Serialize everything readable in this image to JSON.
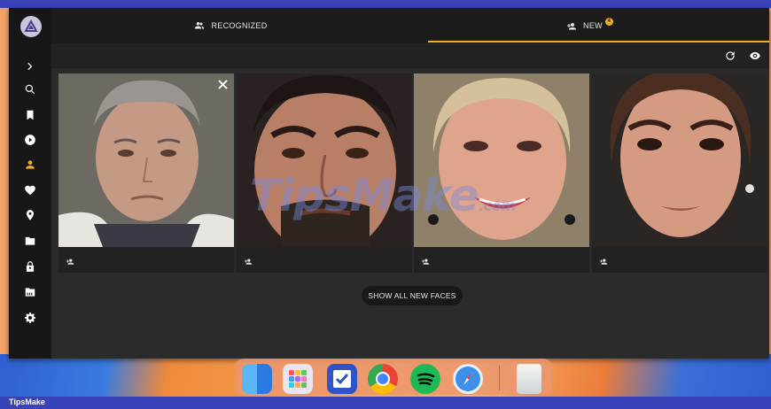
{
  "tabs": {
    "recognized_label": "RECOGNIZED",
    "new_label": "NEW",
    "new_count": "4"
  },
  "sidebar": {
    "items": [
      {
        "icon": "chevron-right-icon"
      },
      {
        "icon": "search-icon"
      },
      {
        "icon": "bookmark-icon"
      },
      {
        "icon": "play-circle-icon"
      },
      {
        "icon": "person-icon",
        "active": true
      },
      {
        "icon": "heart-icon"
      },
      {
        "icon": "location-pin-icon"
      },
      {
        "icon": "folder-icon"
      },
      {
        "icon": "lock-icon"
      },
      {
        "icon": "film-folder-icon"
      },
      {
        "icon": "gear-icon"
      }
    ]
  },
  "toolbar": {
    "icons": [
      "refresh-icon",
      "eye-icon"
    ]
  },
  "faces": [
    {
      "skin": "#c49a84",
      "hair": "#9a9590",
      "bg": "#6d6a64"
    },
    {
      "skin": "#b97f66",
      "hair": "#1e1614",
      "bg": "#2a2220"
    },
    {
      "skin": "#e0a38c",
      "hair": "#d4c09a",
      "bg": "#3d3430"
    },
    {
      "skin": "#d49a82",
      "hair": "#4a2e22",
      "bg": "#2a2624"
    }
  ],
  "show_all_label": "SHOW ALL NEW FACES",
  "watermark": {
    "text": "TipsMake",
    "suffix": ".com"
  },
  "taskbar": {
    "brand": "TipsMake"
  },
  "colors": {
    "accent": "#f2b01e",
    "app_bg": "#2b2b2b",
    "rail_bg": "#171717"
  }
}
